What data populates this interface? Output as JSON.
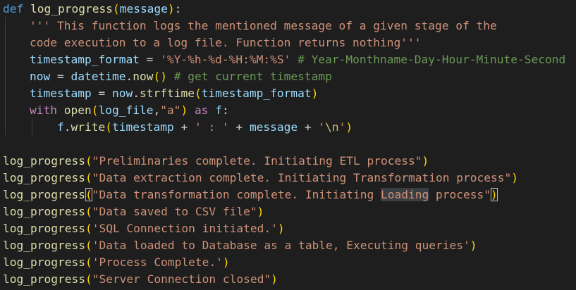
{
  "code": {
    "def_kw": "def",
    "func_name": "log_progress",
    "param": "message",
    "docstring_line1": "''' This function logs the mentioned message of a given stage of the",
    "docstring_line2": "code execution to a log file. Function returns nothing'''",
    "ts_format_var": "timestamp_format",
    "ts_format_str": "'%Y-%h-%d-%H:%M:%S'",
    "ts_format_comment": "# Year-Monthname-Day-Hour-Minute-Second",
    "now_var": "now",
    "now_class": "datetime",
    "now_method": "now",
    "now_comment": "# get current timestamp",
    "ts_var": "timestamp",
    "strftime_method": "strftime",
    "with_kw": "with",
    "open_fn": "open",
    "log_file_var": "log_file",
    "mode_str": "\"a\"",
    "as_kw": "as",
    "f_var": "f",
    "write_method": "write",
    "sep_str": "' : '",
    "newline_escape": "\\n",
    "calls": [
      "\"Preliminaries complete. Initiating ETL process\"",
      "\"Data extraction complete. Initiating Transformation process\"",
      "\"Data transformation complete. Initiating Loading process\"",
      "\"Data saved to CSV file\"",
      "'SQL Connection initiated.'",
      "'Data loaded to Database as a table, Executing queries'",
      "'Process Complete.'",
      "\"Server Connection closed\""
    ],
    "selected_word": "Loading"
  },
  "colors": {
    "background": "#1e1e1e",
    "keyword": "#569cd6",
    "control_keyword": "#c586c0",
    "function": "#dcdcaa",
    "variable": "#9cdcfe",
    "string": "#ce9178",
    "comment": "#6a9955",
    "bracket_level1": "#ffd700",
    "bracket_level2": "#da70d6"
  }
}
